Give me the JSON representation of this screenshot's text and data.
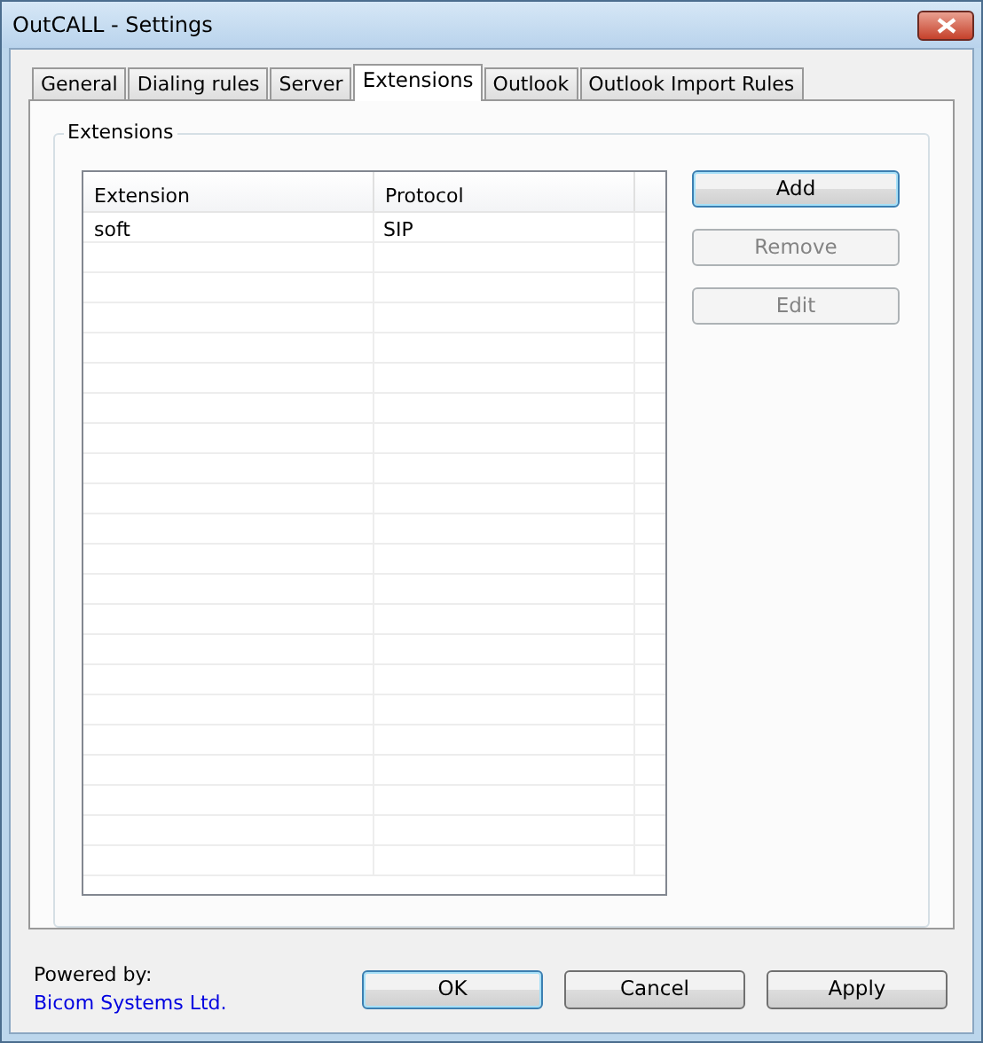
{
  "window": {
    "title": "OutCALL - Settings"
  },
  "tabs": [
    {
      "label": "General",
      "selected": false
    },
    {
      "label": "Dialing rules",
      "selected": false
    },
    {
      "label": "Server",
      "selected": false
    },
    {
      "label": "Extensions",
      "selected": true
    },
    {
      "label": "Outlook",
      "selected": false
    },
    {
      "label": "Outlook Import Rules",
      "selected": false
    }
  ],
  "group": {
    "title": "Extensions"
  },
  "table": {
    "columns": [
      "Extension",
      "Protocol"
    ],
    "rows": [
      [
        "soft",
        "SIP"
      ]
    ]
  },
  "side_buttons": [
    {
      "label": "Add",
      "disabled": false,
      "default": true
    },
    {
      "label": "Remove",
      "disabled": true,
      "default": false
    },
    {
      "label": "Edit",
      "disabled": true,
      "default": false
    }
  ],
  "footer": {
    "powered_by": "Powered by:",
    "link": "Bicom Systems Ltd."
  },
  "buttons": [
    {
      "label": "OK",
      "default": true
    },
    {
      "label": "Cancel",
      "default": false
    },
    {
      "label": "Apply",
      "default": false
    }
  ]
}
